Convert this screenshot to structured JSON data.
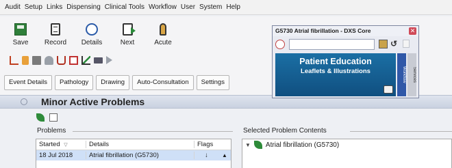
{
  "menubar": {
    "items": [
      "Audit",
      "Setup",
      "Links",
      "Dispensing",
      "Clinical Tools",
      "Workflow",
      "User",
      "System",
      "Help"
    ]
  },
  "toolbar": {
    "save_label": "Save",
    "record_label": "Record",
    "details_label": "Details",
    "next_label": "Next",
    "acute_label": "Acute"
  },
  "tabs": [
    "Event Details",
    "Pathology",
    "Drawing",
    "Auto-Consultation",
    "Settings"
  ],
  "section": {
    "title": "Minor Active Problems"
  },
  "problems": {
    "group_title": "Problems",
    "headers": {
      "started": "Started",
      "sort_indicator": "▽",
      "details": "Details",
      "flags": "Flags"
    },
    "rows": [
      {
        "started": "18 Jul 2018",
        "details": "Atrial fibrillation (G5730)",
        "flag": "↓"
      }
    ]
  },
  "selected_contents": {
    "group_title": "Selected Problem Contents",
    "item": "Atrial fibrillation (G5730)"
  },
  "popup": {
    "title": "G5730 Atrial fibrillation - DXS Core",
    "search_value": "",
    "banner_title": "Patient Education",
    "banner_subtitle": "Leaflets & Illustrations",
    "side_tabs": [
      "Workflow",
      "Services"
    ]
  },
  "colors": {
    "accent": "#104f80",
    "section_header": "#c9d1e0",
    "selected_row": "#cfe0f7"
  }
}
